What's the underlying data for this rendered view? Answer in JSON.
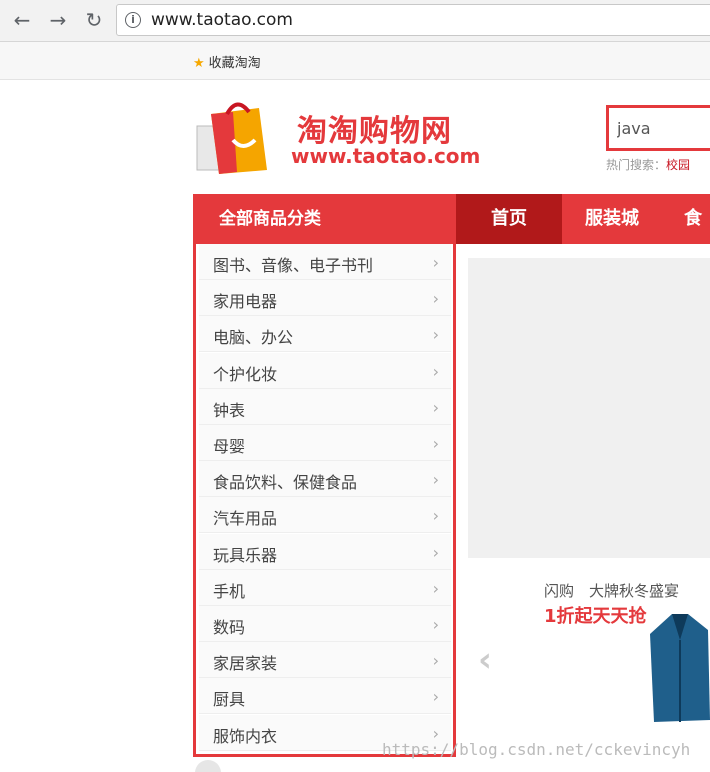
{
  "browser": {
    "url": "www.taotao.com",
    "bookmark": "收藏淘淘"
  },
  "header": {
    "logo_title": "淘淘购物网",
    "logo_url": "www.taotao.com",
    "search_value": "java",
    "hot_label": "热门搜索：",
    "hot_first": "校园"
  },
  "nav": {
    "all_categories": "全部商品分类",
    "items": [
      "首页",
      "服装城",
      "食"
    ]
  },
  "categories": [
    "图书、音像、电子书刊",
    "家用电器",
    "电脑、办公",
    "个护化妆",
    "钟表",
    "母婴",
    "食品饮料、保健食品",
    "汽车用品",
    "玩具乐器",
    "手机",
    "数码",
    "家居家装",
    "厨具",
    "服饰内衣"
  ],
  "promo": {
    "line1": "闪购　大牌秋冬盛宴",
    "line2": "1折起天天抢"
  },
  "watermark": "https://blog.csdn.net/cckevincyh",
  "colors": {
    "brand_red": "#e4393c",
    "active_red": "#b1191a"
  }
}
